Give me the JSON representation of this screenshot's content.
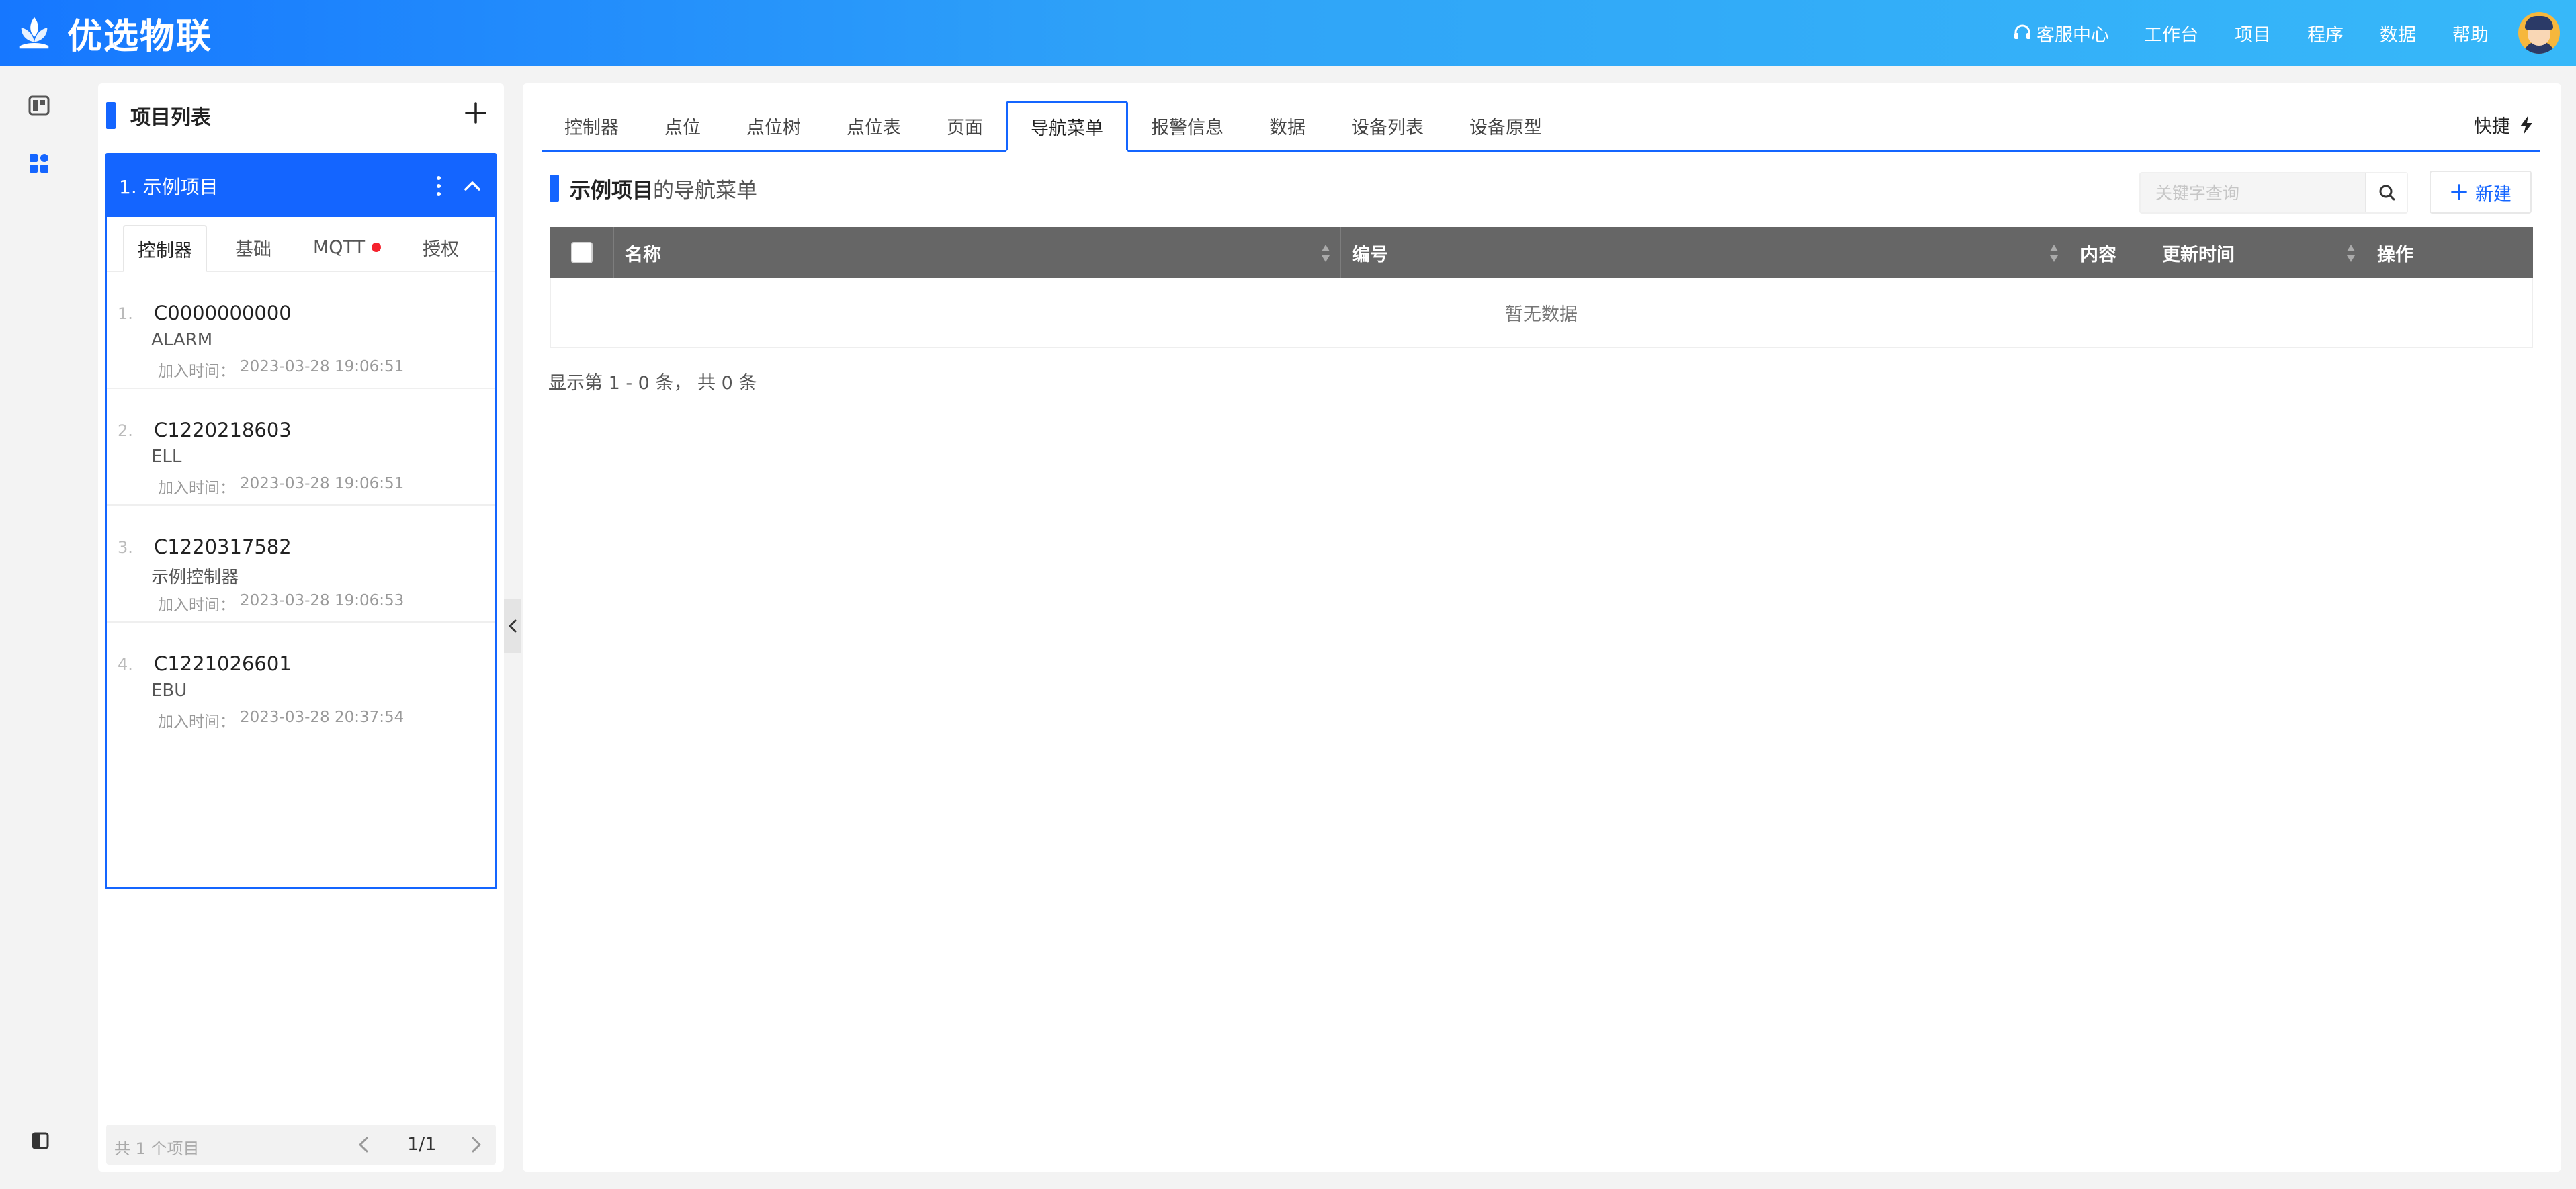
{
  "header": {
    "app_name": "优选物联",
    "nav": [
      {
        "label": "客服中心",
        "icon": "headset-icon"
      },
      {
        "label": "工作台"
      },
      {
        "label": "项目"
      },
      {
        "label": "程序"
      },
      {
        "label": "数据"
      },
      {
        "label": "帮助"
      }
    ],
    "avatar_icon": "user-avatar"
  },
  "rail": {
    "icons": [
      "layout-icon",
      "apps-grid-icon",
      "sidebar-toggle-icon"
    ],
    "accent_color": "#1465ff"
  },
  "project_panel": {
    "title": "项目列表",
    "add_icon": "plus-icon",
    "project": {
      "label": "1. 示例项目",
      "more_icon": "kebab-icon",
      "collapse_icon": "chevron-up-icon"
    },
    "subtabs": [
      {
        "label": "控制器",
        "active": true
      },
      {
        "label": "基础"
      },
      {
        "label": "MQTT",
        "has_dot": true
      },
      {
        "label": "授权"
      }
    ],
    "controllers": [
      {
        "index": "1.",
        "code": "C0000000000",
        "name": "ALARM",
        "time_label": "加入时间：",
        "time": "2023-03-28 19:06:51"
      },
      {
        "index": "2.",
        "code": "C1220218603",
        "name": "ELL",
        "time_label": "加入时间：",
        "time": "2023-03-28 19:06:51"
      },
      {
        "index": "3.",
        "code": "C1220317582",
        "name": "示例控制器",
        "time_label": "加入时间：",
        "time": "2023-03-28 19:06:53"
      },
      {
        "index": "4.",
        "code": "C1221026601",
        "name": "EBU",
        "time_label": "加入时间：",
        "time": "2023-03-28 20:37:54"
      }
    ],
    "pager": {
      "total_text": "共 1 个项目",
      "page": "1/1"
    }
  },
  "main": {
    "tabs": [
      {
        "label": "控制器"
      },
      {
        "label": "点位"
      },
      {
        "label": "点位树"
      },
      {
        "label": "点位表"
      },
      {
        "label": "页面"
      },
      {
        "label": "导航菜单",
        "active": true
      },
      {
        "label": "报警信息"
      },
      {
        "label": "数据"
      },
      {
        "label": "设备列表"
      },
      {
        "label": "设备原型"
      }
    ],
    "quick_label": "快捷",
    "section_title_strong": "示例项目",
    "section_title_rest": "的导航菜单",
    "search_placeholder": "关键字查询",
    "new_label": "新建",
    "table": {
      "columns": [
        "名称",
        "编号",
        "内容",
        "更新时间",
        "操作"
      ],
      "empty_text": "暂无数据"
    },
    "summary": "显示第 1 - 0 条， 共 0 条"
  }
}
